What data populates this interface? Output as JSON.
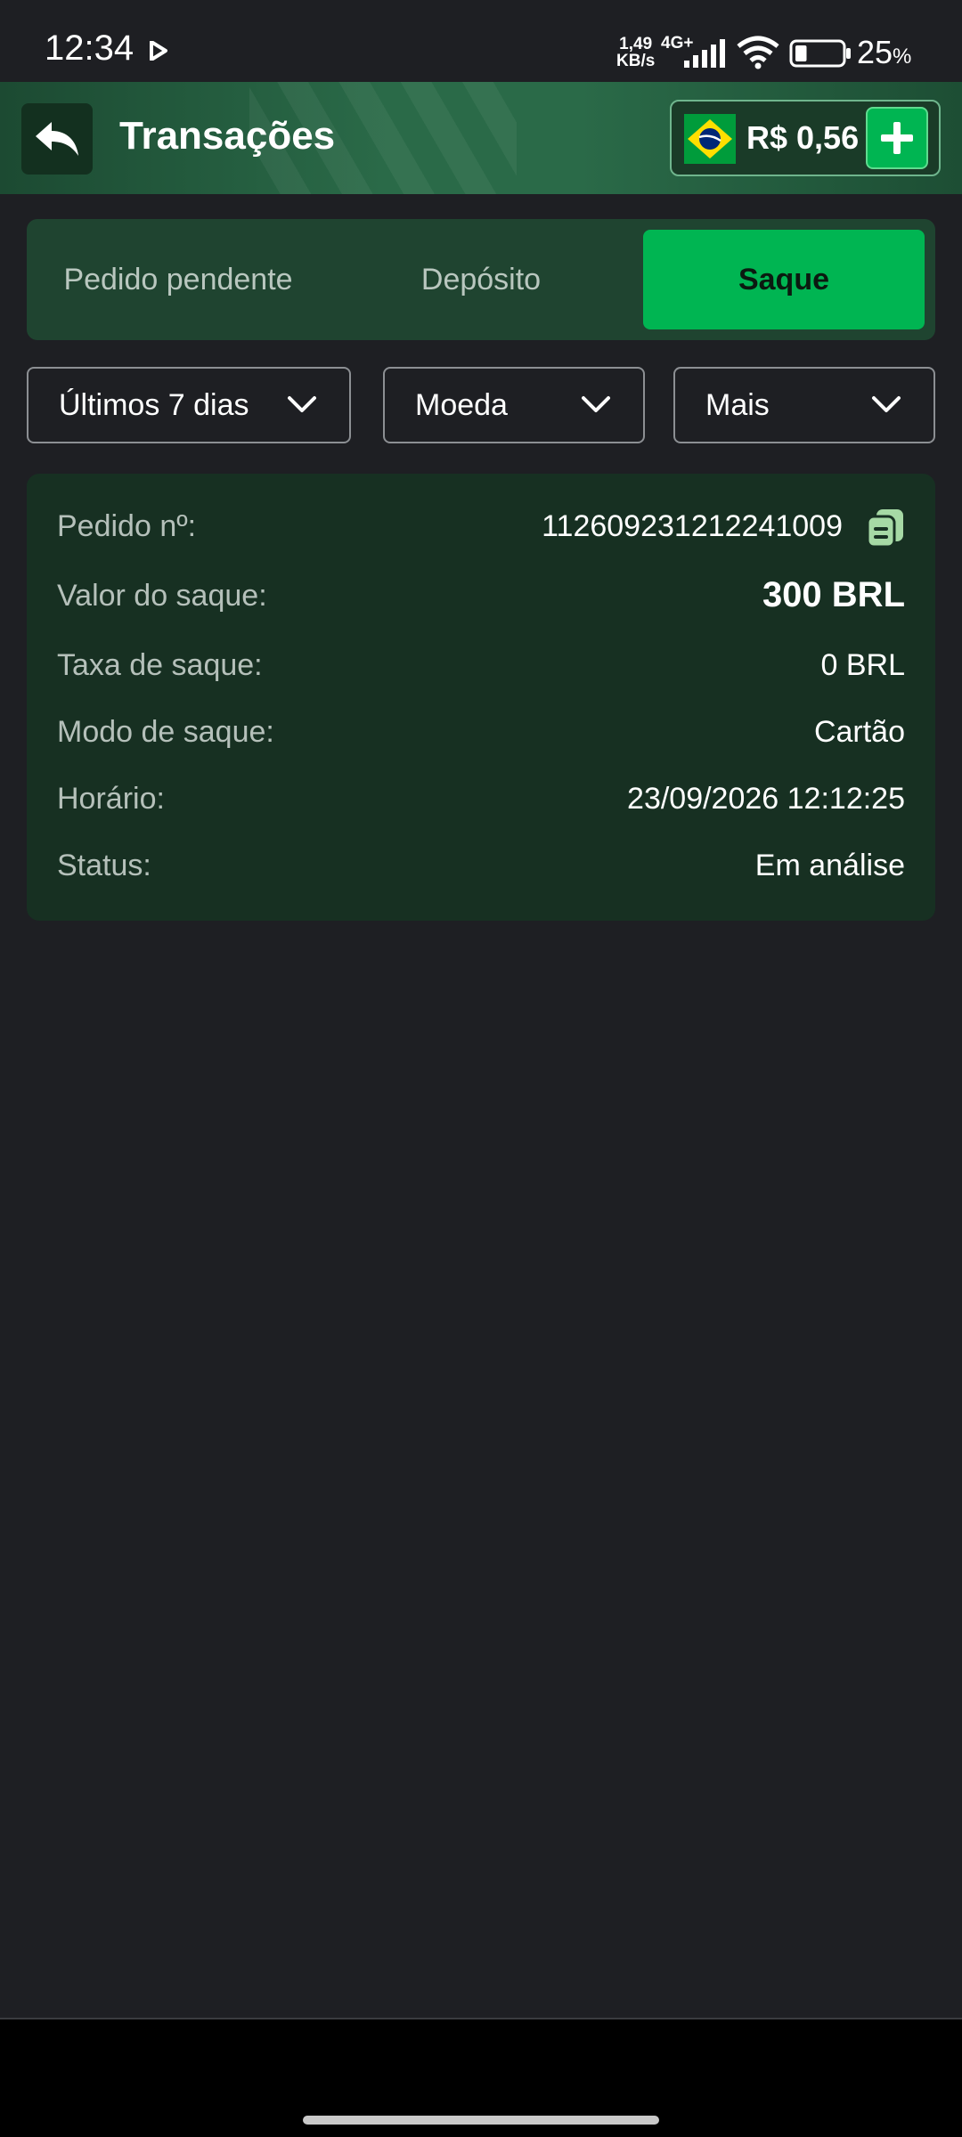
{
  "status_bar": {
    "time": "12:34",
    "speed_value": "1,49",
    "speed_unit": "KB/s",
    "network": "4G+",
    "battery_pct": "25",
    "battery_unit": "%",
    "battery_level": 0.25
  },
  "header": {
    "title": "Transações",
    "balance": "R$ 0,56",
    "icons": {
      "back": "back-arrow-icon",
      "add": "plus-icon",
      "flag": "brazil-flag-icon"
    }
  },
  "tabs": [
    {
      "label": "Pedido pendente",
      "active": false
    },
    {
      "label": "Depósito",
      "active": false
    },
    {
      "label": "Saque",
      "active": true
    }
  ],
  "filters": {
    "period": "Últimos 7 dias",
    "currency": "Moeda",
    "more": "Mais"
  },
  "transaction": {
    "order_label": "Pedido nº:",
    "order_value": "112609231212241009",
    "amount_label": "Valor do saque:",
    "amount_value": "300 BRL",
    "fee_label": "Taxa de saque:",
    "fee_value": "0 BRL",
    "mode_label": "Modo de saque:",
    "mode_value": "Cartão",
    "time_label": "Horário:",
    "time_value": "23/09/2026 12:12:25",
    "status_label": "Status:",
    "status_value": "Em análise"
  },
  "colors": {
    "accent_green": "#00b552",
    "card_bg": "#173022",
    "page_bg": "#1e1f23"
  }
}
